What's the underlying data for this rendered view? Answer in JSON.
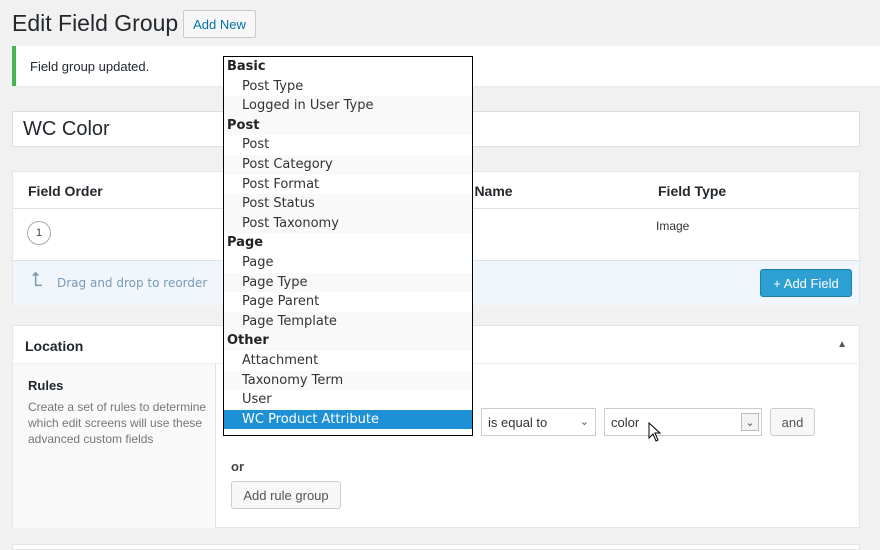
{
  "page": {
    "title": "Edit Field Group",
    "add_new": "Add New"
  },
  "notice": "Field group updated.",
  "field_group_title": "WC Color",
  "fields": {
    "headers": {
      "order": "Field Order",
      "name": "d Name",
      "type": "Field Type"
    },
    "rows": [
      {
        "order": "1",
        "type": "Image"
      }
    ],
    "reorder_hint": "Drag and drop to reorder",
    "add_field": "+ Add Field"
  },
  "location": {
    "title": "Location",
    "rules_label": "Rules",
    "rules_desc": "Create a set of rules to determine which edit screens will use these advanced custom fields",
    "operator": "is equal to",
    "value": "color",
    "and": "and",
    "or": "or",
    "add_rule_group": "Add rule group"
  },
  "dropdown": {
    "groups": [
      {
        "label": "Basic",
        "items": [
          "Post Type",
          "Logged in User Type"
        ]
      },
      {
        "label": "Post",
        "items": [
          "Post",
          "Post Category",
          "Post Format",
          "Post Status",
          "Post Taxonomy"
        ]
      },
      {
        "label": "Page",
        "items": [
          "Page",
          "Page Type",
          "Page Parent",
          "Page Template"
        ]
      },
      {
        "label": "Other",
        "items": [
          "Attachment",
          "Taxonomy Term",
          "User",
          "WC Product Attribute"
        ]
      }
    ],
    "selected": "WC Product Attribute"
  },
  "colors": {
    "accent": "#0073aa",
    "success": "#46b450",
    "primary_button": "#2e9fd3",
    "selection": "#1e90d6"
  }
}
